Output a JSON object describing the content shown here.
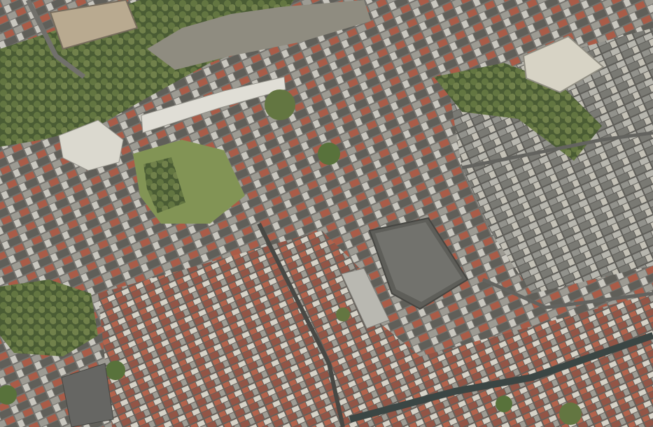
{
  "image": {
    "subject": "aerial-city-photograph",
    "palette": {
      "ground": "#4a4a44",
      "street": "#5b5a55",
      "roof_grey": "#8e8c86",
      "roof_dark": "#5e5d59",
      "roof_light": "#c9c6bd",
      "roof_red": "#a8523c",
      "roof_brick": "#8f4a3a",
      "tree": "#5b6e35",
      "tree_dark": "#3f5227",
      "lawn": "#7c8f4a",
      "facade_cream": "#d8d3c4",
      "canal": "#2f3a38"
    }
  }
}
